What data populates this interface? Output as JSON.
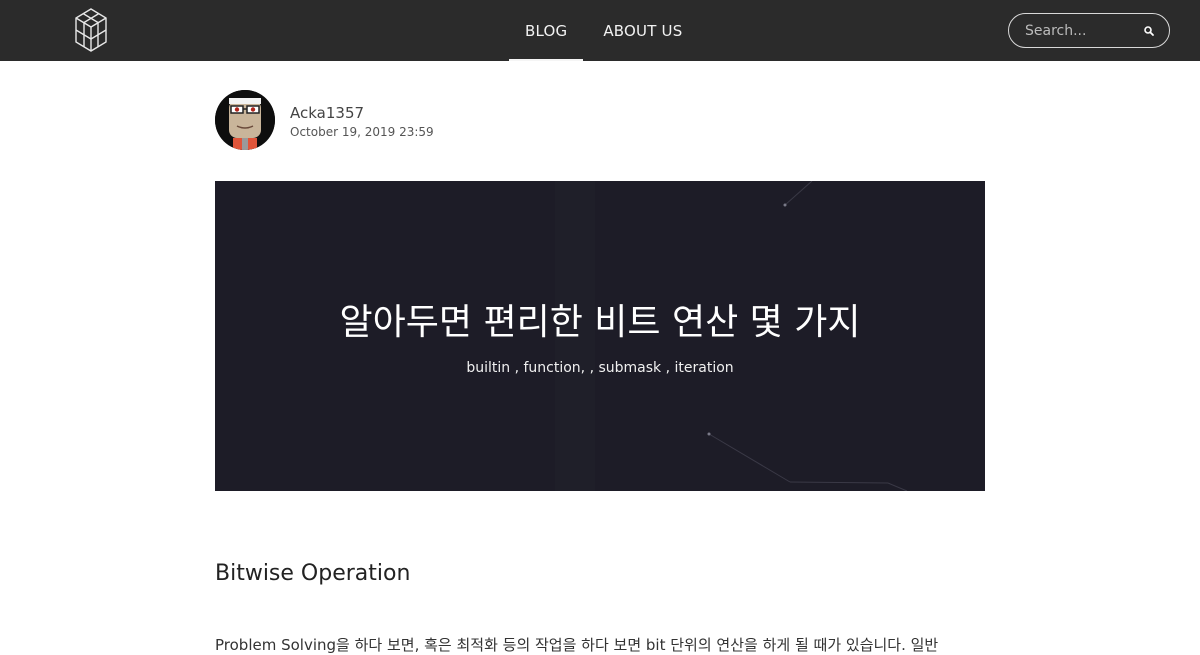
{
  "header": {
    "logo_icon": "cube-lattice-logo-icon",
    "nav": [
      {
        "label": "BLOG",
        "active": true
      },
      {
        "label": "ABOUT US",
        "active": false
      }
    ],
    "search": {
      "placeholder": "Search...",
      "value": "",
      "icon": "search-icon"
    }
  },
  "post": {
    "author": {
      "name": "Acka1357",
      "date": "October 19, 2019 23:59",
      "avatar_icon": "cartoon-avatar"
    },
    "hero": {
      "title": "알아두면 편리한 비트 연산 몇 가지",
      "tags_text": "builtin , function, , submask , iteration"
    },
    "section_heading": "Bitwise Operation",
    "first_paragraph": "Problem Solving을 하다 보면, 혹은 최적화 등의 작업을 하다 보면 bit 단위의 연산을 하게 될 때가 있습니다. 일반"
  },
  "colors": {
    "topbar": "#2b2b2b",
    "hero_bg": "#1d1c27",
    "text": "#222222"
  }
}
